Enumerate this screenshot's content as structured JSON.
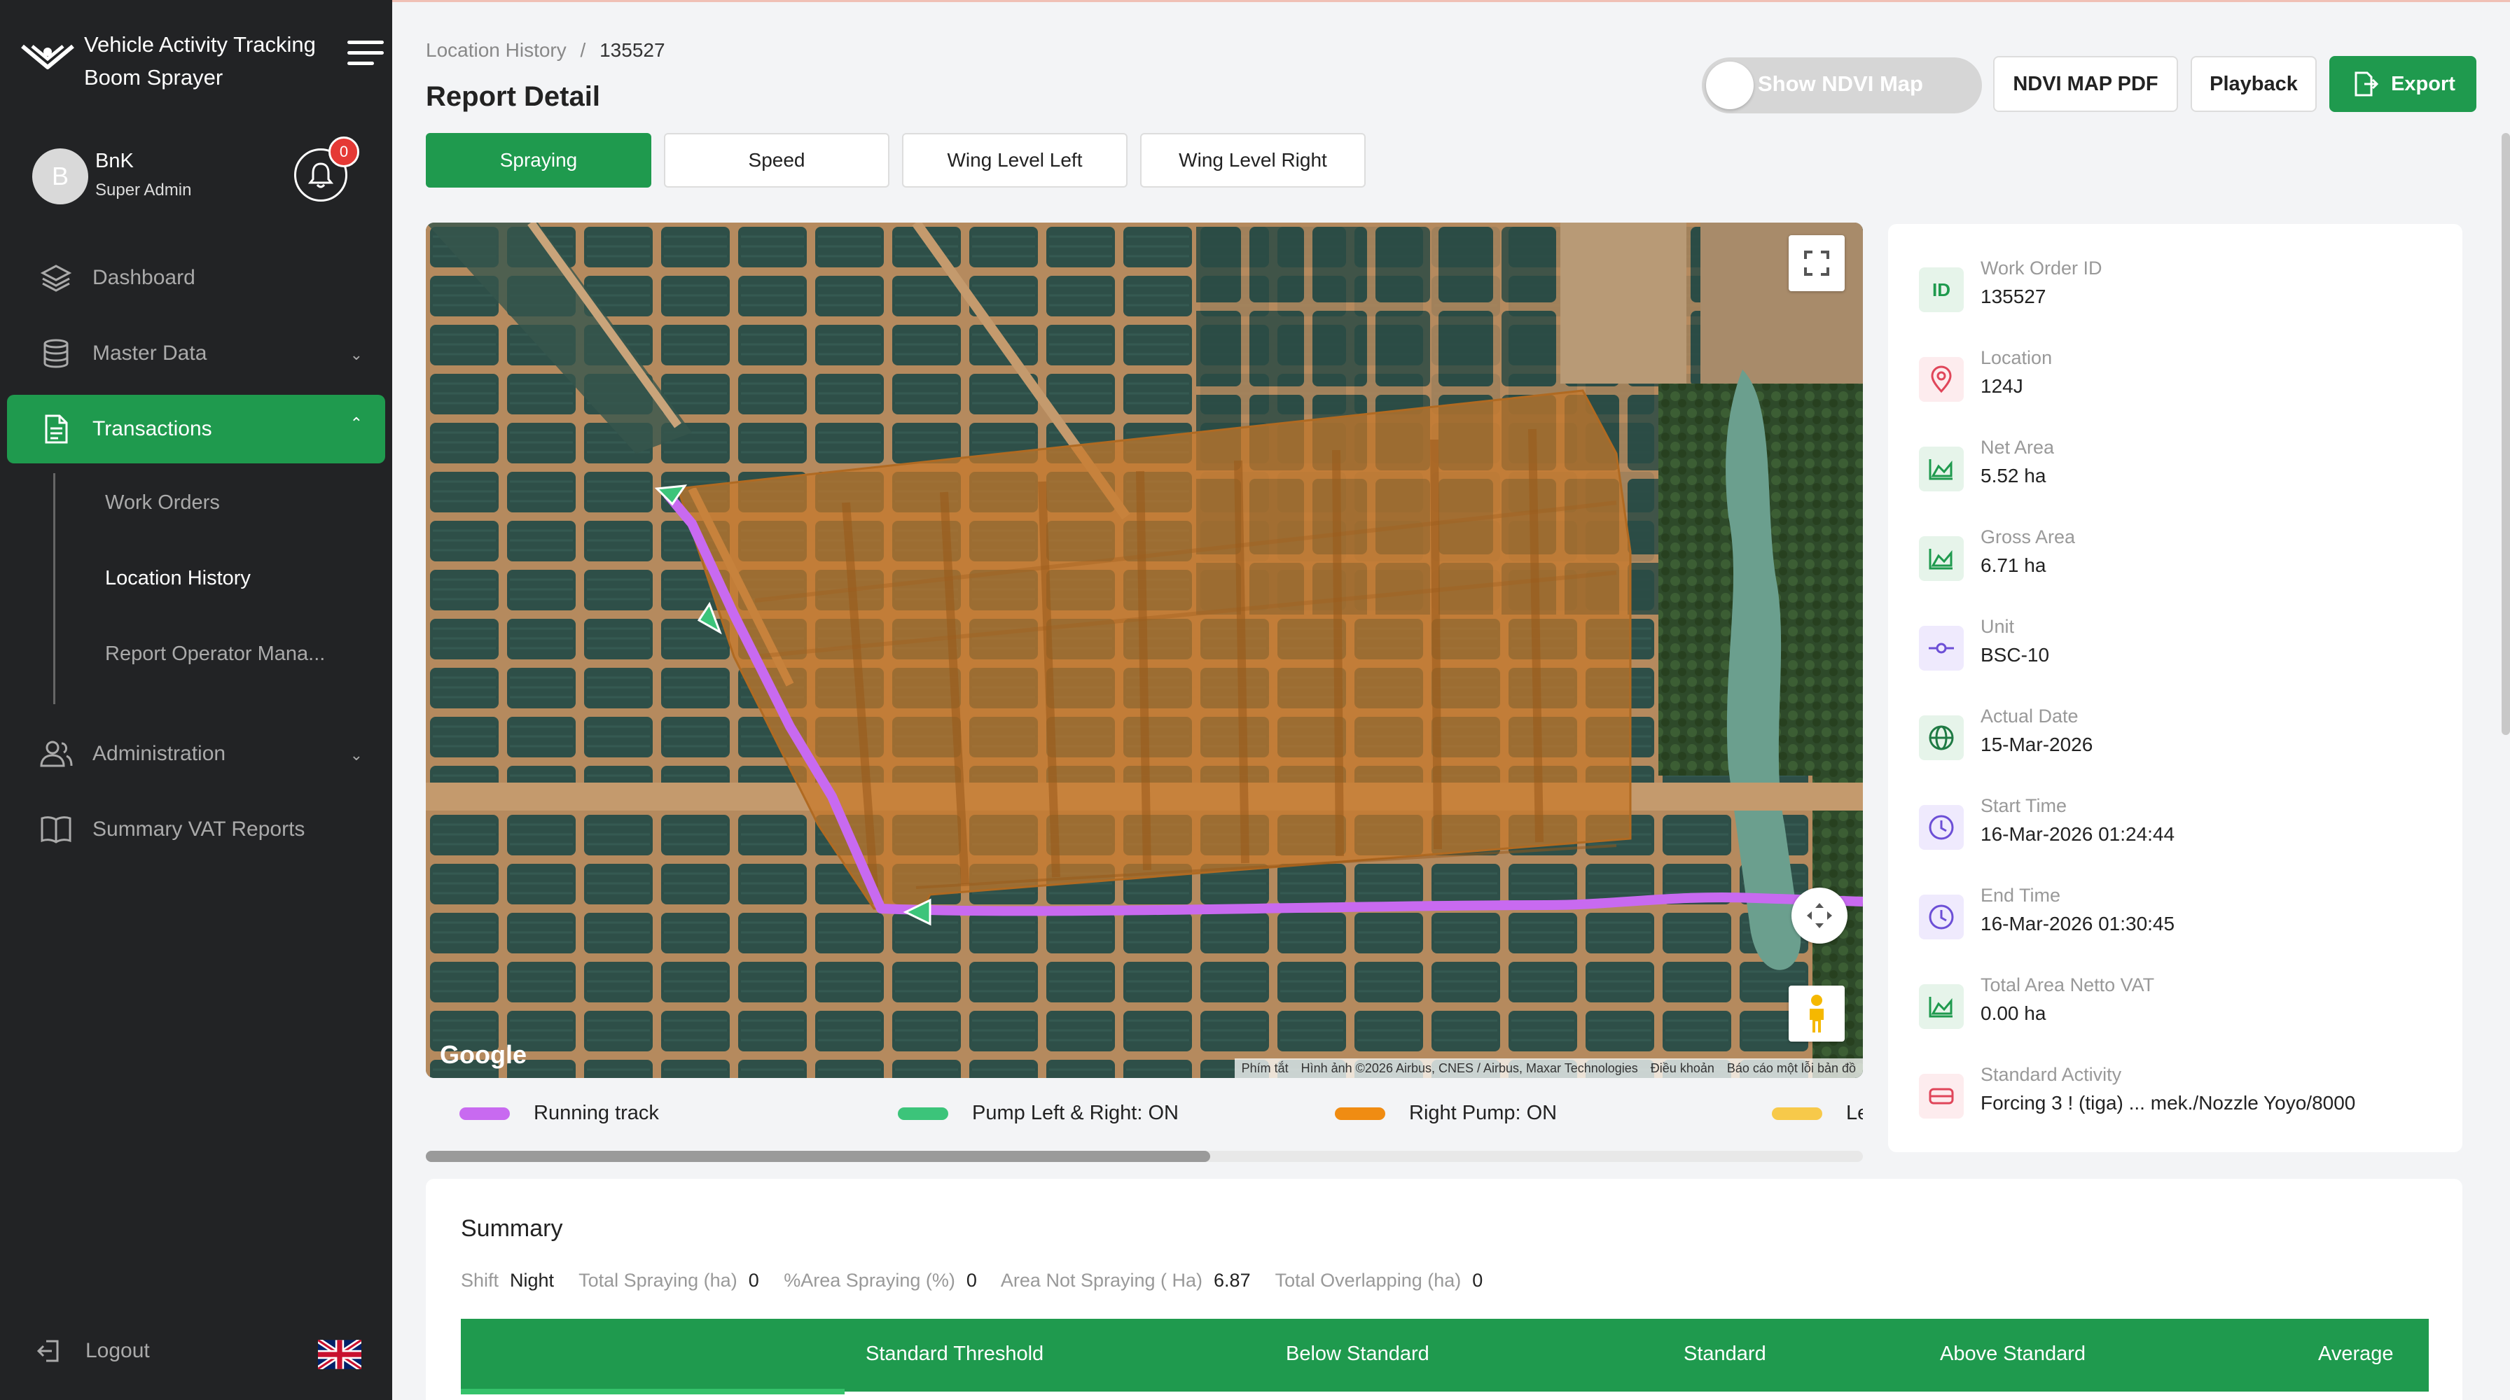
{
  "app": {
    "title_line1": "Vehicle Activity Tracking",
    "title_line2": "Boom Sprayer"
  },
  "user": {
    "initial": "B",
    "name": "BnK",
    "role": "Super Admin",
    "notifications": "0"
  },
  "nav": {
    "dashboard": "Dashboard",
    "master_data": "Master Data",
    "transactions": "Transactions",
    "sub": {
      "work_orders": "Work Orders",
      "location_history": "Location History",
      "report_operator": "Report Operator Mana..."
    },
    "administration": "Administration",
    "summary_vat": "Summary VAT Reports",
    "logout": "Logout"
  },
  "breadcrumb": {
    "parent": "Location History",
    "separator": "/",
    "current": "135527"
  },
  "page": {
    "title": "Report Detail"
  },
  "toolbar": {
    "ndvi_toggle": "Show NDVI Map",
    "ndvi_pdf": "NDVI MAP PDF",
    "playback": "Playback",
    "export": "Export"
  },
  "tabs": [
    "Spraying",
    "Speed",
    "Wing Level Left",
    "Wing Level Right"
  ],
  "map": {
    "google": "Google",
    "attribution": [
      "Phím tắt",
      "Hình ảnh ©2026 Airbus, CNES / Airbus, Maxar Technologies",
      "Điều khoản",
      "Báo cáo một lỗi bản đồ"
    ]
  },
  "legend": [
    {
      "label": "Running track",
      "color": "#c86af0"
    },
    {
      "label": "Pump Left & Right: ON",
      "color": "#3cc47a"
    },
    {
      "label": "Right Pump: ON",
      "color": "#f08c12"
    },
    {
      "label": "Le",
      "color": "#f7c94a"
    }
  ],
  "details": [
    {
      "label": "Work Order ID",
      "value": "135527",
      "icon": "id-icon",
      "badge": "ID"
    },
    {
      "label": "Location",
      "value": "124J",
      "icon": "location-pin-icon"
    },
    {
      "label": "Net Area",
      "value": "5.52 ha",
      "icon": "area-chart-icon"
    },
    {
      "label": "Gross Area",
      "value": "6.71 ha",
      "icon": "area-chart-icon"
    },
    {
      "label": "Unit",
      "value": "BSC-10",
      "icon": "unit-commit-icon"
    },
    {
      "label": "Actual Date",
      "value": "15-Mar-2026",
      "icon": "globe-icon"
    },
    {
      "label": "Start Time",
      "value": "16-Mar-2026 01:24:44",
      "icon": "clock-icon"
    },
    {
      "label": "End Time",
      "value": "16-Mar-2026 01:30:45",
      "icon": "clock-icon"
    },
    {
      "label": "Total Area Netto VAT",
      "value": "0.00 ha",
      "icon": "area-chart-icon"
    },
    {
      "label": "Standard Activity",
      "value": "Forcing 3 ! (tiga) ... mek./Nozzle Yoyo/8000",
      "icon": "tanker-icon"
    }
  ],
  "summary": {
    "title": "Summary",
    "shift_label": "Shift",
    "shift": "Night",
    "total_spraying_label": "Total Spraying (ha)",
    "total_spraying": "0",
    "area_spraying_label": "%Area Spraying (%)",
    "area_spraying": "0",
    "area_not_spraying_label": "Area Not Spraying ( Ha)",
    "area_not_spraying": "6.87",
    "total_overlapping_label": "Total Overlapping (ha)",
    "total_overlapping": "0",
    "columns": [
      "Standard Threshold",
      "Below Standard",
      "Standard",
      "Above Standard",
      "Average"
    ]
  },
  "colors": {
    "primary": "#1f9a4e",
    "sidebar": "#222325",
    "badge": "#e53935",
    "track": "#c86af0",
    "area": "#c8782a"
  }
}
